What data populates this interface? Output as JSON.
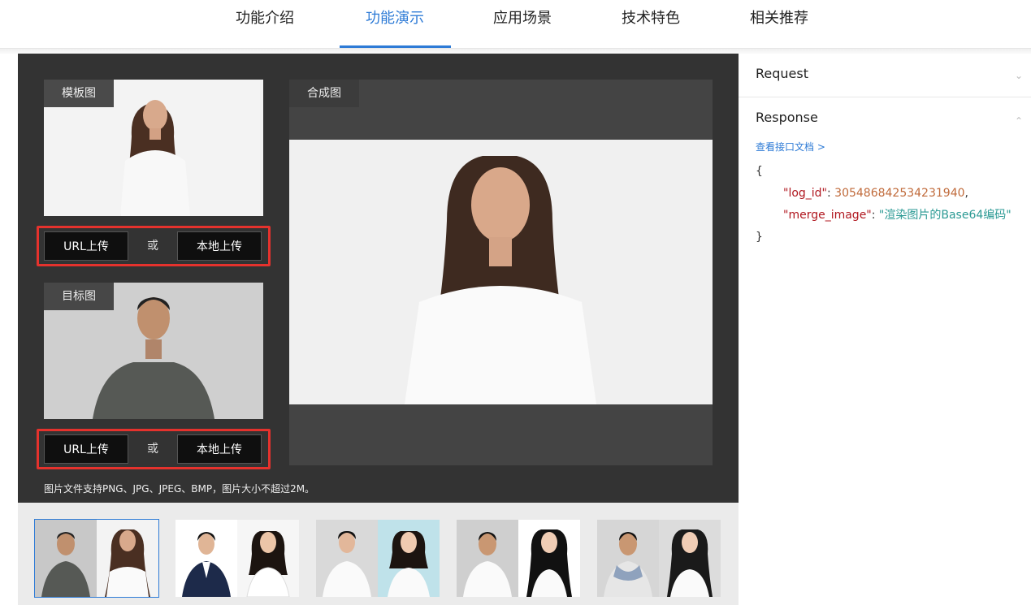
{
  "nav": {
    "tabs": [
      "功能介绍",
      "功能演示",
      "应用场景",
      "技术特色",
      "相关推荐"
    ],
    "active_index": 1
  },
  "demo": {
    "template_label": "模板图",
    "target_label": "目标图",
    "result_label": "合成图",
    "url_upload": "URL上传",
    "or": "或",
    "local_upload": "本地上传",
    "note": "图片文件支持PNG、JPG、JPEG、BMP，图片大小不超过2M。"
  },
  "thumbs": {
    "count": 5,
    "selected_index": 0
  },
  "side": {
    "request_title": "Request",
    "response_title": "Response",
    "doc_link": "查看接口文档 >",
    "code": {
      "open": "{",
      "key1": "\"log_id\"",
      "val1": "305486842534231940",
      "key2": "\"merge_image\"",
      "val2": "\"渲染图片的Base64编码\"",
      "close": "}"
    }
  },
  "colors": {
    "accent": "#2e7bd6",
    "highlight": "#e5322d",
    "panel": "#333333"
  }
}
